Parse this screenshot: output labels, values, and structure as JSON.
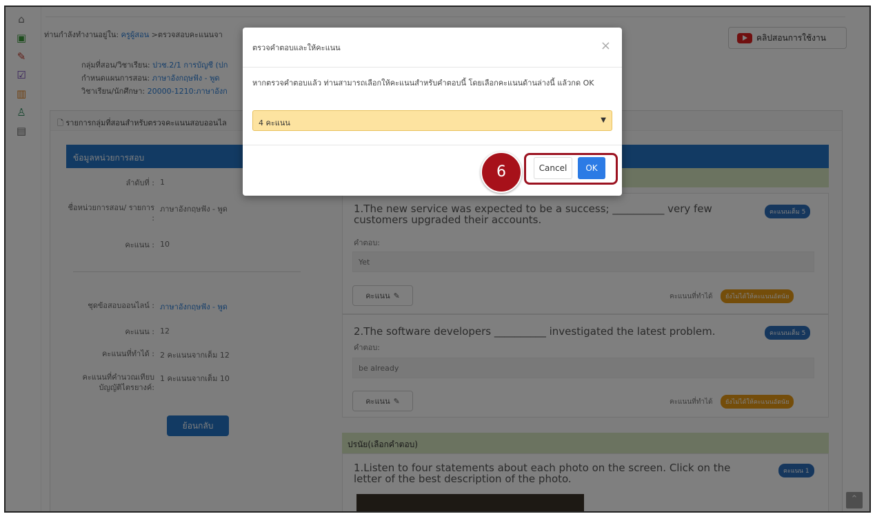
{
  "breadcrumb": {
    "prefix": "ท่านกำลังทำงานอยู่ใน:",
    "link": "ครูผู้สอน",
    "rest": ">ตรวจสอบคะแนนจา"
  },
  "help_button": {
    "label": "คลิปสอนการใช้งาน",
    "icon": "youtube-icon"
  },
  "info": {
    "group_label": "กลุ่มที่สอน/วิชาเรียน:",
    "group_value": "ปวช.2/1 การบัญชี (ปก",
    "plan_label": "กำหนดแผนการสอน:",
    "plan_value": "ภาษาอังกฤษฟัง - พูด",
    "subject_label": "วิชาเรียน/นักศึกษา:",
    "subject_value": "20000-1210:ภาษาอังก"
  },
  "panel_title": "รายการกลุ่มที่สอนสำหรับตรวจคะแนนสอบออนไล",
  "left_card": {
    "header": "ข้อมูลหน่วยการสอบ",
    "order_label": "ลำดับที่ :",
    "order_value": "1",
    "unit_label": "ชื่อหน่วยการสอน/ รายการ :",
    "unit_value": "ภาษาอังกฤษฟัง - พูด",
    "score_label": "คะแนน :",
    "score_value": "10",
    "set_label": "ชุดข้อสอบออนไลน์ :",
    "set_value": "ภาษาอังกฤษฟัง - พูด",
    "set_score_label": "คะแนน :",
    "set_score_value": "12",
    "earned_label": "คะแนนที่ทำได้ :",
    "earned_value": "2 คะแนนจากเต็ม 12",
    "calc_label": "คะแนนที่คำนวณเทียบ บัญญัติไตรยางค์:",
    "calc_value": "1 คะแนนจากเต็ม 10",
    "back_button": "ย้อนกลับ"
  },
  "questions": [
    {
      "text": "1.The new service was expected to be a success; __________ very few customers upgraded their accounts.",
      "badge": "คะแนนเต็ม 5",
      "answer_label": "คำตอบ:",
      "answer": "Yet",
      "score_button": "คะแนน",
      "earned_label": "คะแนนที่ทำได้",
      "status": "ยังไม่ได้ให้คะแนนอัตนัย"
    },
    {
      "text": "2.The software developers __________ investigated the latest problem.",
      "badge": "คะแนนเต็ม 5",
      "answer_label": "คำตอบ:",
      "answer": "be already",
      "score_button": "คะแนน",
      "earned_label": "คะแนนที่ทำได้",
      "status": "ยังไม่ได้ให้คะแนนอัตนัย"
    }
  ],
  "section2": {
    "title": "ปรนัย(เลือกคำตอบ)",
    "question": "1.Listen to four statements about each photo on the screen. Click on the letter of the best description of the photo.",
    "badge": "คะแนน 1"
  },
  "modal": {
    "title": "ตรวจคำตอบและให้คะแนน",
    "close": "×",
    "text": "หากตรวจคำตอบแล้ว ท่านสามารถเลือกให้คะแนนสำหรับคำตอบนี้ โดยเลือกคะแนนด้านล่างนี้ แล้วกด OK",
    "select_value": "4 คะแนน",
    "cancel": "Cancel",
    "ok": "OK"
  },
  "step_number": "6",
  "colors": {
    "primary": "#2474c6",
    "section_green": "#d7e6c0",
    "select_yellow": "#fde3a0",
    "step_red": "#a7111a",
    "ok_blue": "#2c7be5"
  }
}
